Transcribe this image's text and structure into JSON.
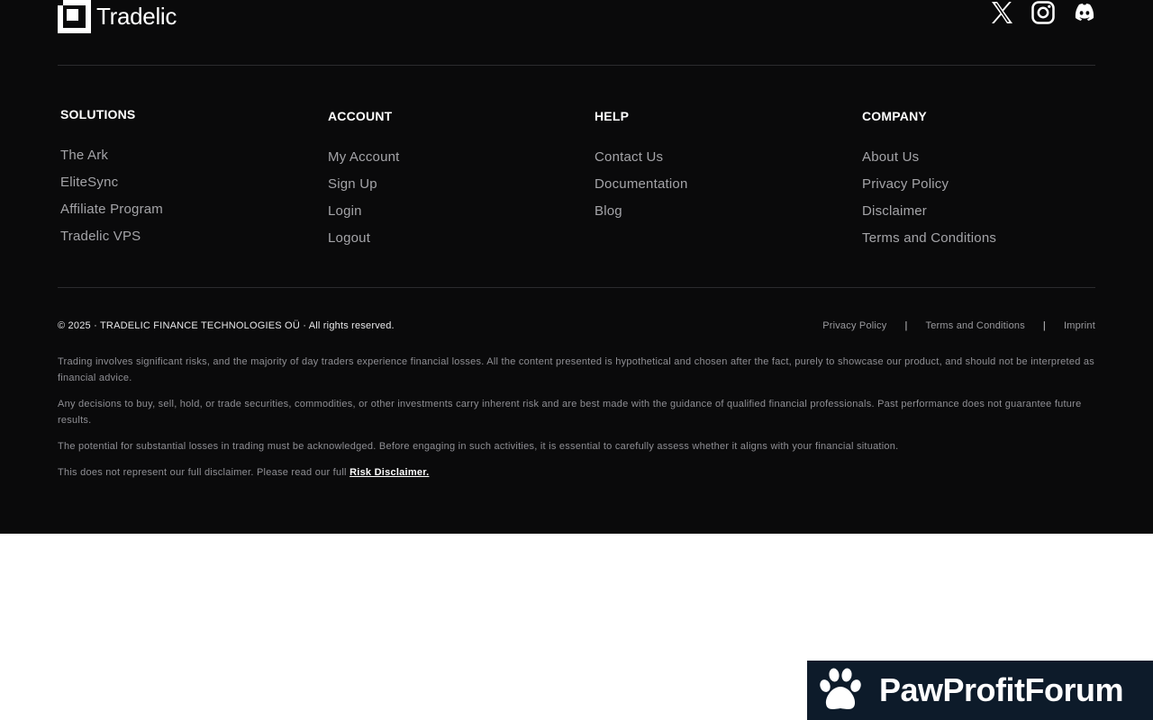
{
  "brand": {
    "name": "Tradelic",
    "logo_icon": "tradelic-logo-icon"
  },
  "social": [
    {
      "name": "X",
      "icon": "x-icon"
    },
    {
      "name": "Instagram",
      "icon": "instagram-icon"
    },
    {
      "name": "Discord",
      "icon": "discord-icon"
    }
  ],
  "columns": [
    {
      "title": "SOLUTIONS",
      "items": [
        "The Ark",
        "EliteSync",
        "Affiliate Program",
        "Tradelic VPS"
      ]
    },
    {
      "title": "ACCOUNT",
      "items": [
        "My Account",
        "Sign Up",
        "Login",
        "Logout"
      ]
    },
    {
      "title": "HELP",
      "items": [
        "Contact Us",
        "Documentation",
        "Blog"
      ]
    },
    {
      "title": "COMPANY",
      "items": [
        "About Us",
        "Privacy Policy",
        "Disclaimer",
        "Terms and Conditions"
      ]
    }
  ],
  "copyright": "© 2025 · TRADELIC FINANCE TECHNOLOGIES OÜ · All rights reserved.",
  "legal_links": [
    "Privacy Policy",
    "Terms and Conditions",
    "Imprint"
  ],
  "legal_separator": "|",
  "disclaimer": {
    "p1": "Trading involves significant risks, and the majority of day traders experience financial losses. All the content presented is hypothetical and chosen after the fact, purely to showcase our product, and should not be interpreted as financial advice.",
    "p2": "Any decisions to buy, sell, hold, or trade securities, commodities, or other investments carry inherent risk and are best made with the guidance of qualified financial professionals. Past performance does not guarantee future results.",
    "p3": "The potential for substantial losses in trading must be acknowledged. Before engaging in such activities, it is essential to carefully assess whether it aligns with your financial situation.",
    "p4_prefix": "This does not represent our full disclaimer. Please read our full",
    "p4_link": "Risk Disclaimer."
  },
  "watermark": {
    "text": "PawProfitForum",
    "icon": "paw-icon"
  },
  "colors": {
    "footer_bg": "#0a0a0b",
    "link_gray": "#a4a4a8",
    "watermark_bg": "#0d1b2a"
  }
}
